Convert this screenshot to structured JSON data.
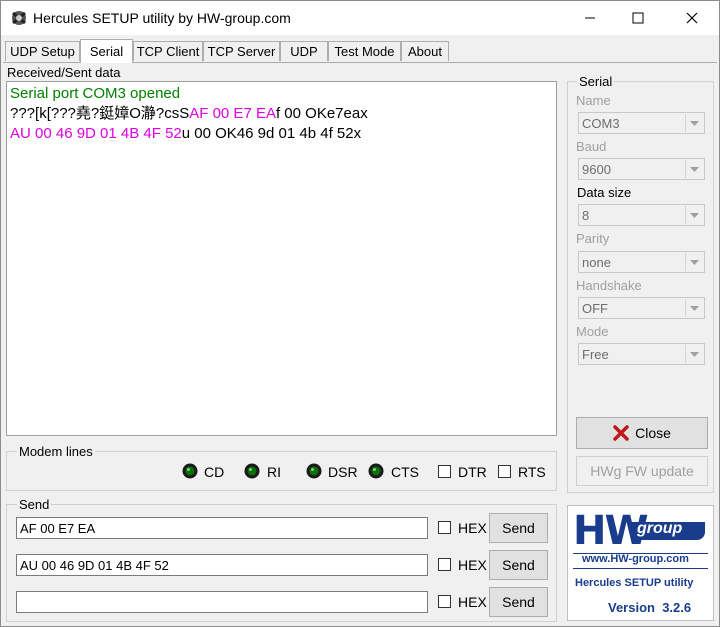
{
  "window": {
    "title": "Hercules SETUP utility by HW-group.com"
  },
  "tabs": [
    "UDP Setup",
    "Serial",
    "TCP Client",
    "TCP Server",
    "UDP",
    "Test Mode",
    "About"
  ],
  "received": {
    "label": "Received/Sent data",
    "lines": [
      [
        {
          "t": "Serial port COM3 opened",
          "c": "green"
        }
      ],
      [
        {
          "t": "???[k[???堯?鋌嫜O瀞?csS",
          "c": "black"
        },
        {
          "t": "AF 00 E7 EA",
          "c": "mag"
        },
        {
          "t": "f 00 OKe7eax",
          "c": "black"
        }
      ],
      [
        {
          "t": "AU 00 46 9D 01 4B 4F 52",
          "c": "mag"
        },
        {
          "t": "u 00 OK46 9d 01 4b 4f 52x",
          "c": "black"
        }
      ]
    ]
  },
  "serial": {
    "title": "Serial",
    "name_label": "Name",
    "name_value": "COM3",
    "baud_label": "Baud",
    "baud_value": "9600",
    "datasize_label": "Data size",
    "datasize_value": "8",
    "parity_label": "Parity",
    "parity_value": "none",
    "handshake_label": "Handshake",
    "handshake_value": "OFF",
    "mode_label": "Mode",
    "mode_value": "Free",
    "close_label": "Close",
    "fw_label": "HWg FW update"
  },
  "modem": {
    "title": "Modem lines",
    "cd": "CD",
    "ri": "RI",
    "dsr": "DSR",
    "cts": "CTS",
    "dtr": "DTR",
    "rts": "RTS"
  },
  "send": {
    "title": "Send",
    "rows": [
      {
        "value": "AF 00 E7 EA",
        "hex": "HEX",
        "button": "Send"
      },
      {
        "value": "AU 00 46 9D 01 4B 4F 52",
        "hex": "HEX",
        "button": "Send"
      },
      {
        "value": "",
        "hex": "HEX",
        "button": "Send"
      }
    ]
  },
  "logo": {
    "brand": "HW",
    "group": "group",
    "url": "www.HW-group.com",
    "product": "Hercules SETUP utility",
    "version": "Version  3.2.6"
  },
  "colors": {
    "green": "#008000",
    "magenta": "#e000e0",
    "logo_blue": "#1a3c8c"
  }
}
